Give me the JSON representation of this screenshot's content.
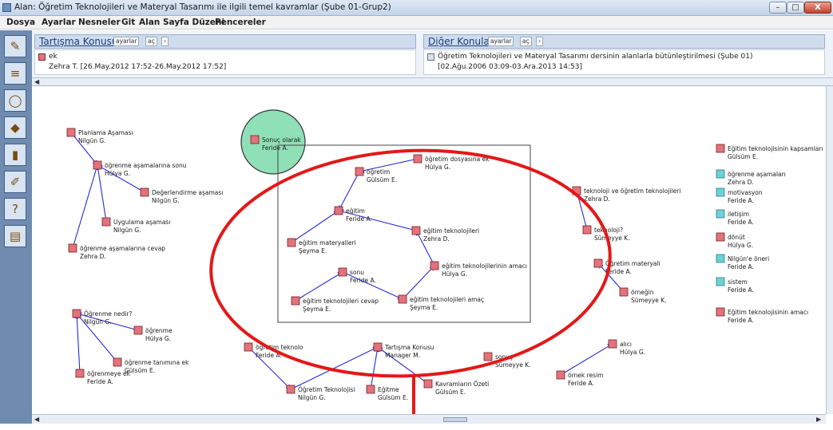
{
  "window": {
    "title": "Alan: Öğretim Teknolojileri ve Materyal Tasarımı ile ilgili temel kavramlar (Şube 01-Grup2)",
    "btn_min": "–",
    "btn_max": "□",
    "btn_close": "X"
  },
  "menu": [
    "Dosya",
    "Ayarlar",
    "Nesneler",
    "Git",
    "Alan",
    "Sayfa Düzeni",
    "Pencereler"
  ],
  "toolbar_icons": [
    "pencil-icon",
    "list-icon",
    "circle-tool-icon",
    "stack-icon",
    "chart-icon",
    "brush-icon",
    "help-icon",
    "page-icon"
  ],
  "discussion_panel": {
    "title": "Tartışma Konusu",
    "settings": "ayarlar",
    "open": "aç",
    "next": "›",
    "item_name": "ek",
    "item_meta": "Zehra T.  [26.May.2012 17:52-26.May.2012 17:52]"
  },
  "other_topics_panel": {
    "title": "Diğer Konular",
    "settings": "ayarlar",
    "open": "aç",
    "next": "›",
    "item_name": "Öğretim Teknolojileri ve Materyal Tasarımı dersinin alanlarla bütünleştirilmesi (Şube 01)",
    "item_meta": "[02.Ağu.2006 03:09-03.Ara.2013 14:53]"
  },
  "nodes": [
    {
      "name": "Planlama Aşaması",
      "author": "Nilgün G."
    },
    {
      "name": "öğrenme aşamalarına sonu",
      "author": "Hülya G."
    },
    {
      "name": "Değerlendirme aşaması",
      "author": "Nilgün G."
    },
    {
      "name": "Uygulama aşaması",
      "author": "Nilgün G."
    },
    {
      "name": "öğrenme aşamalarına cevap",
      "author": "Zehra D."
    },
    {
      "name": "Sonuç olarak",
      "author": "Feride A."
    },
    {
      "name": "öğretim dosyasına ek",
      "author": "Hülya G."
    },
    {
      "name": "öğretim",
      "author": "Gülsüm E."
    },
    {
      "name": "eğitim",
      "author": "Feride A."
    },
    {
      "name": "eğitim materyalleri",
      "author": "Şeyma E."
    },
    {
      "name": "eğitim teknolojileri",
      "author": "Zehra D."
    },
    {
      "name": "eğitim teknolojilerinin amacı",
      "author": "Hülya G."
    },
    {
      "name": "sonu",
      "author": "Feride A."
    },
    {
      "name": "eğitim teknolojileri cevap",
      "author": "Şeyma E."
    },
    {
      "name": "eğitim teknolojileri amaç",
      "author": "Şeyma E."
    },
    {
      "name": "teknoloji ve öğretim teknolojileri",
      "author": "Zehra D."
    },
    {
      "name": "teknoloji?",
      "author": "Sümeyye K."
    },
    {
      "name": "Öğretim materyali",
      "author": "Feride A."
    },
    {
      "name": "örneğin",
      "author": "Sümeyye K."
    },
    {
      "name": "Öğrenme nedir?",
      "author": "Nilgün G."
    },
    {
      "name": "öğrenme",
      "author": "Hülya G."
    },
    {
      "name": "öğrenme tanımına ek",
      "author": "Gülsüm E."
    },
    {
      "name": "öğrenmeye ek",
      "author": "Feride A."
    },
    {
      "name": "öğretim teknolo",
      "author": "Feride A."
    },
    {
      "name": "Öğretim Teknolojisi",
      "author": "Nilgün G."
    },
    {
      "name": "Tartışma Konusu",
      "author": "Manager M."
    },
    {
      "name": "Eğitme",
      "author": "Gülsüm E."
    },
    {
      "name": "sonuç",
      "author": "Sümeyye K."
    },
    {
      "name": "Kavramların Özeti",
      "author": "Gülsüm E."
    },
    {
      "name": "alıcı",
      "author": "Hülya G."
    },
    {
      "name": "örnek resim",
      "author": "Feride A."
    },
    {
      "name": "Eğitim teknolojisinin kapsamları",
      "author": "Gülsüm E."
    },
    {
      "name": "öğrenme aşamaları",
      "author": "Zehra D."
    },
    {
      "name": "motivasyon",
      "author": "Feride A."
    },
    {
      "name": "iletişim",
      "author": "Feride A."
    },
    {
      "name": "dönüt",
      "author": "Hülya G."
    },
    {
      "name": "Nilgün'e öneri",
      "author": "Feride A."
    },
    {
      "name": "sistem",
      "author": "Feride A."
    },
    {
      "name": "Eğitim teknolojisinin amacı",
      "author": "Feride A."
    }
  ],
  "colors": {
    "node_red": "#e0747a",
    "node_cyan": "#6ed0d8",
    "arrow": "#2b2bd6",
    "annotation": "#e31818",
    "highlight_circle": "#8fe0b7"
  }
}
